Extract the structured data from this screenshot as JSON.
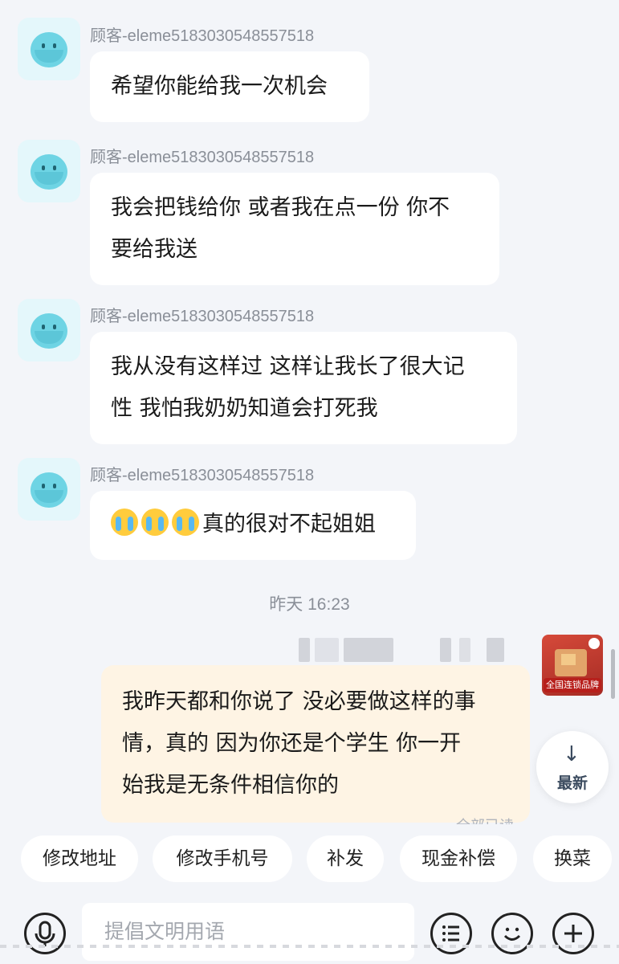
{
  "messages": [
    {
      "sender": "顾客-eleme5183030548557518",
      "lines": [
        "希望你能给我一次机会"
      ]
    },
    {
      "sender": "顾客-eleme5183030548557518",
      "lines": [
        "我会把钱给你 或者我在点一份 你不",
        "要给我送"
      ]
    },
    {
      "sender": "顾客-eleme5183030548557518",
      "lines": [
        "我从没有这样过 这样让我长了很大记",
        "性 我怕我奶奶知道会打死我"
      ]
    },
    {
      "sender": "顾客-eleme5183030548557518",
      "lines": [
        "真的很对不起姐姐"
      ]
    }
  ],
  "timestamp": "昨天 16:23",
  "outgoing": {
    "lines": [
      "我昨天都和你说了 没必要做这样的事",
      "情，真的 因为你还是个学生 你一开",
      "始我是无条件相信你的"
    ]
  },
  "read_status": "全部已读",
  "ad_badge": "全国连锁品牌",
  "latest_button": {
    "arrow": "↓",
    "label": "最新"
  },
  "quick_replies": [
    "修改地址",
    "修改手机号",
    "补发",
    "现金补偿",
    "换菜"
  ],
  "input": {
    "placeholder": "提倡文明用语"
  },
  "icons": [
    "microphone-icon",
    "list-icon",
    "emoji-icon",
    "plus-icon"
  ]
}
